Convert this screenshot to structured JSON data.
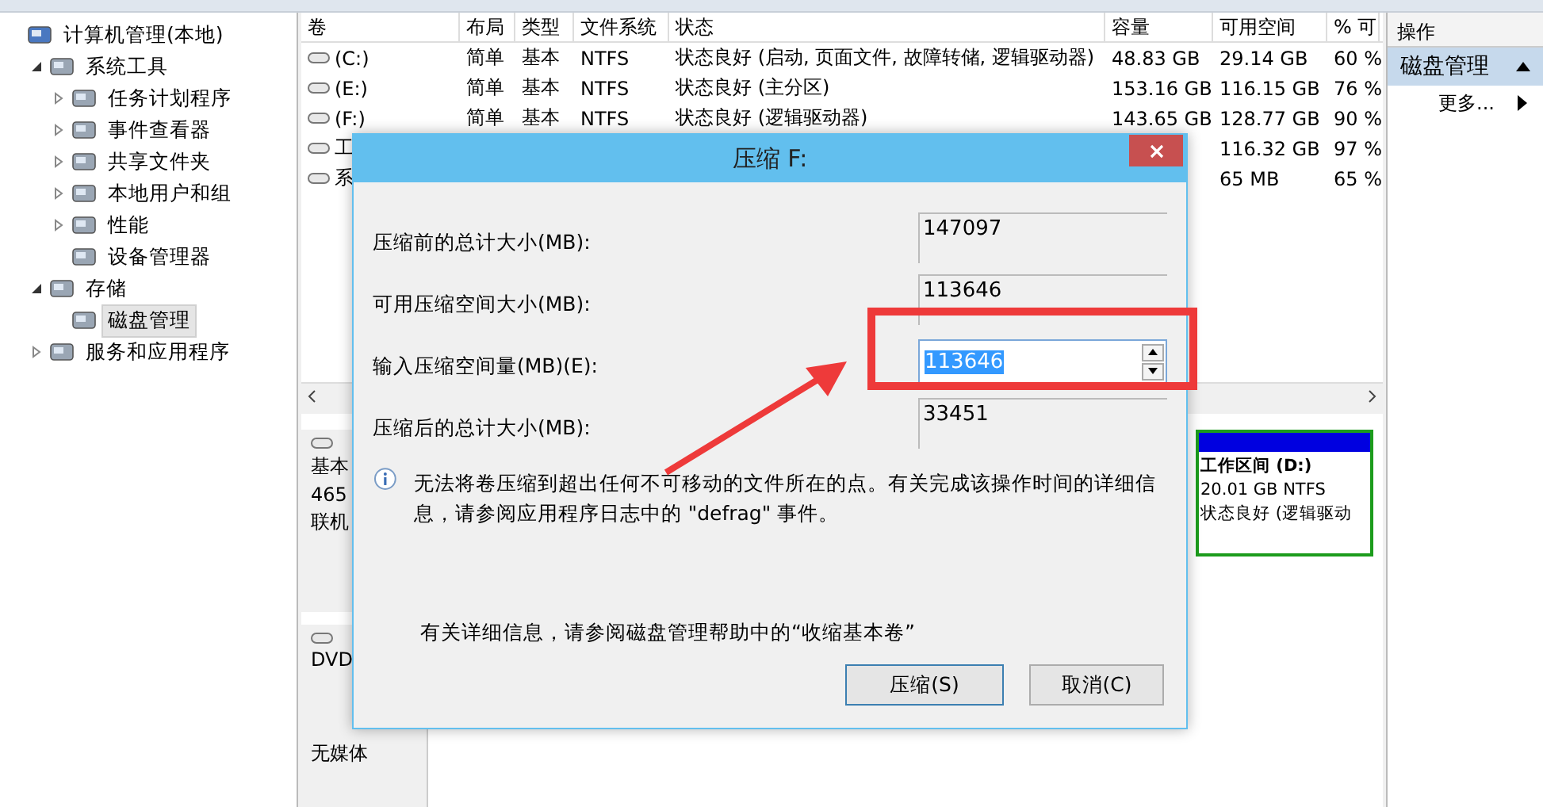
{
  "tree": [
    {
      "label": "计算机管理(本地)",
      "selected": false,
      "children": [
        {
          "label": "系统工具",
          "expanded": true,
          "selected": false,
          "children": [
            {
              "label": "任务计划程序",
              "expanded": false,
              "selected": false
            },
            {
              "label": "事件查看器",
              "expanded": false,
              "selected": false
            },
            {
              "label": "共享文件夹",
              "expanded": false,
              "selected": false
            },
            {
              "label": "本地用户和组",
              "expanded": false,
              "selected": false
            },
            {
              "label": "性能",
              "expanded": false,
              "selected": false
            },
            {
              "label": "设备管理器",
              "selected": false
            }
          ]
        },
        {
          "label": "存储",
          "expanded": true,
          "selected": false,
          "children": [
            {
              "label": "磁盘管理",
              "selected": true
            }
          ]
        },
        {
          "label": "服务和应用程序",
          "expanded": false,
          "selected": false
        }
      ]
    }
  ],
  "table": {
    "columns": [
      "卷",
      "布局",
      "类型",
      "文件系统",
      "状态",
      "容量",
      "可用空间",
      "% 可"
    ],
    "rows": [
      [
        "(C:)",
        "简单",
        "基本",
        "NTFS",
        "状态良好 (启动, 页面文件, 故障转储, 逻辑驱动器)",
        "48.83 GB",
        "29.14 GB",
        "60 %"
      ],
      [
        "(E:)",
        "简单",
        "基本",
        "NTFS",
        "状态良好 (主分区)",
        "153.16 GB",
        "116.15 GB",
        "76 %"
      ],
      [
        "(F:)",
        "简单",
        "基本",
        "NTFS",
        "状态良好 (逻辑驱动器)",
        "143.65 GB",
        "128.77 GB",
        "90 %"
      ],
      [
        "工",
        "",
        "",
        "",
        "",
        "",
        "116.32 GB",
        "97 %"
      ],
      [
        "系",
        "",
        "",
        "",
        "",
        "",
        "65 MB",
        "65 %"
      ]
    ]
  },
  "disks": [
    {
      "lines": [
        "基本",
        "465",
        "联机"
      ],
      "partition": {
        "name": "工作区间  (D:)",
        "size": "20.01 GB NTFS",
        "status": "状态良好 (逻辑驱动"
      }
    },
    {
      "lines": [
        "DVD"
      ],
      "media": "无媒体"
    }
  ],
  "actions": {
    "header": "操作",
    "section": "磁盘管理",
    "items": [
      "更多..."
    ]
  },
  "dialog": {
    "title": "压缩 F:",
    "fields": [
      {
        "kind": "readonly",
        "label": "压缩前的总计大小(MB):",
        "value": "147097"
      },
      {
        "kind": "readonly",
        "label": "可用压缩空间大小(MB):",
        "value": "113646"
      },
      {
        "kind": "spinner",
        "label": "输入压缩空间量(MB)(E):",
        "value": "113646"
      },
      {
        "kind": "readonly",
        "label": "压缩后的总计大小(MB):",
        "value": "33451"
      }
    ],
    "info": "无法将卷压缩到超出任何不可移动的文件所在的点。有关完成该操作时间的详细信息，请参阅应用程序日志中的 \"defrag\" 事件。",
    "help": "有关详细信息，请参阅磁盘管理帮助中的“收缩基本卷”",
    "buttons": [
      {
        "label": "压缩(S)",
        "default": true
      },
      {
        "label": "取消(C)",
        "default": false
      }
    ]
  }
}
